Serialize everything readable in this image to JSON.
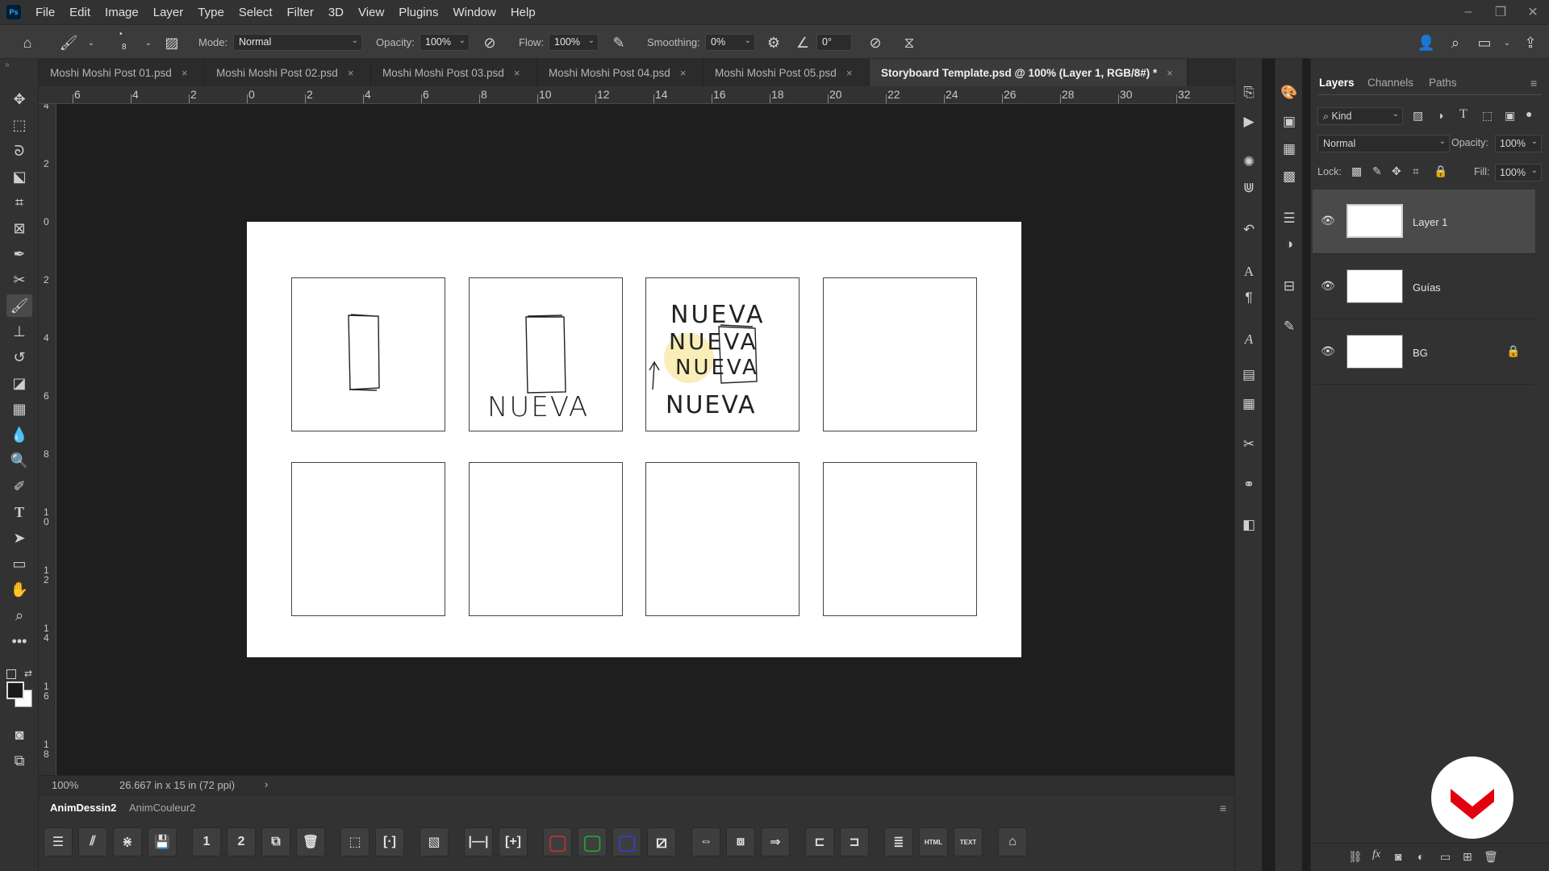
{
  "menu": [
    "File",
    "Edit",
    "Image",
    "Layer",
    "Type",
    "Select",
    "Filter",
    "3D",
    "View",
    "Plugins",
    "Window",
    "Help"
  ],
  "app_logo": "Ps",
  "window_controls": [
    "minimize-icon",
    "restore-icon",
    "close-icon"
  ],
  "options_bar": {
    "brush_size": "8",
    "mode_label": "Mode:",
    "mode_value": "Normal",
    "opacity_label": "Opacity:",
    "opacity_value": "100%",
    "flow_label": "Flow:",
    "flow_value": "100%",
    "smoothing_label": "Smoothing:",
    "smoothing_value": "0%",
    "angle_value": "0°"
  },
  "tabs": [
    {
      "label": "Moshi Moshi Post 01.psd",
      "close": "×"
    },
    {
      "label": "Moshi Moshi Post 02.psd",
      "close": "×"
    },
    {
      "label": "Moshi Moshi Post 03.psd",
      "close": "×"
    },
    {
      "label": "Moshi Moshi Post 04.psd",
      "close": "×"
    },
    {
      "label": "Moshi Moshi Post 05.psd",
      "close": "×"
    },
    {
      "label": "Storyboard Template.psd @ 100% (Layer 1, RGB/8#) *",
      "close": "×",
      "active": true
    }
  ],
  "ruler_h": [
    "6",
    "4",
    "2",
    "0",
    "2",
    "4",
    "6",
    "8",
    "10",
    "12",
    "14",
    "16",
    "18",
    "20",
    "22",
    "24",
    "26",
    "28",
    "30",
    "32"
  ],
  "ruler_v": [
    "4",
    "2",
    "0",
    "2",
    "4",
    "6",
    "8",
    "1\n0",
    "1\n2",
    "1\n4",
    "1\n6",
    "1\n8"
  ],
  "canvas": {
    "sketch_text_1": "NUEVA",
    "sketch_text_2": "NUEVA",
    "sketch_text_3": "NUEVA",
    "sketch_text_4": "NUEVA",
    "sketch_text_5": "NUEVA"
  },
  "status": {
    "zoom": "100%",
    "doc_size": "26.667 in x 15 in (72 ppi)",
    "arrow": "›"
  },
  "anim_panel": {
    "tabs": [
      "AnimDessin2",
      "AnimCouleur2"
    ],
    "button_icons": [
      "timeline-icon",
      "clapper-icon",
      "onion-skin-icon",
      "save-icon",
      "frame-1-icon",
      "frame-2-icon",
      "frames-stack-icon",
      "trash-icon",
      "select-frames-icon",
      "bracket-icon",
      "film-icon",
      "extend-icon",
      "insert-icon",
      "red-square-icon",
      "green-square-icon",
      "blue-square-icon",
      "empty-square-icon",
      "frame-left-icon",
      "frame-center-icon",
      "frame-right-icon",
      "trim-left-icon",
      "trim-right-icon",
      "notes-icon",
      "html-icon",
      "text-icon",
      "export-icon"
    ],
    "button_labels": [
      "",
      "",
      "",
      "",
      "1",
      "2",
      "",
      "",
      "",
      "[·]",
      "",
      "|—|",
      "[+]",
      "",
      "",
      "",
      "",
      "",
      "",
      "",
      "",
      "",
      "",
      "HTML",
      "TEXT",
      ""
    ],
    "accent_red": "#d03030",
    "accent_green": "#20b030",
    "accent_blue": "#3040e0"
  },
  "layers_panel": {
    "tabs": [
      "Layers",
      "Channels",
      "Paths"
    ],
    "kind_label": "Kind",
    "blend_mode": "Normal",
    "opacity_label": "Opacity:",
    "opacity_value": "100%",
    "lock_label": "Lock:",
    "fill_label": "Fill:",
    "fill_value": "100%",
    "layers": [
      {
        "name": "Layer 1",
        "selected": true,
        "locked": false
      },
      {
        "name": "Guías",
        "selected": false,
        "locked": false
      },
      {
        "name": "BG",
        "selected": false,
        "locked": true
      }
    ]
  },
  "brand_color": "#e3000f"
}
